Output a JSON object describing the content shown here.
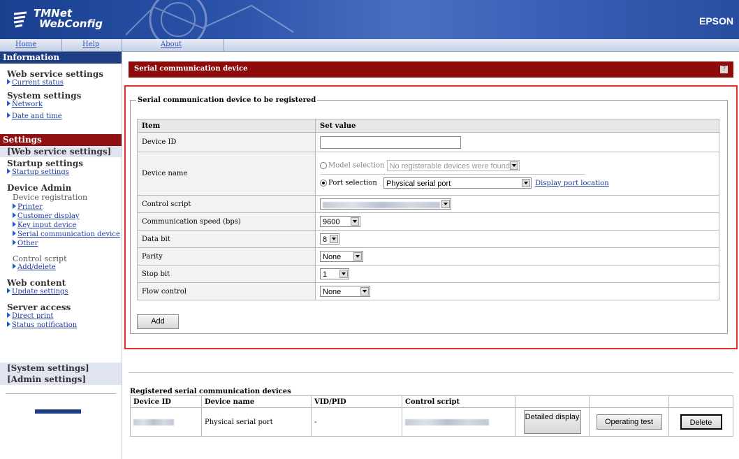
{
  "header": {
    "logo_line1": "TMNet",
    "logo_line2": "WebConfig",
    "brand": "EPSON"
  },
  "nav": {
    "home": "Home",
    "help": "Help",
    "about": "About"
  },
  "sidebar": {
    "info_head": "Information",
    "web_service_settings": "Web service settings",
    "current_status": "Current status",
    "system_settings": "System settings",
    "network": "Network",
    "date_time": "Date and time",
    "settings_head": "Settings",
    "web_service_bar": "[Web service settings]",
    "startup_settings_title": "Startup settings",
    "startup_settings": "Startup settings",
    "device_admin": "Device Admin",
    "device_registration": "Device registration",
    "printer": "Printer",
    "customer_display": "Customer display",
    "key_input_device": "Key input device",
    "serial_comm_device": "Serial communication device",
    "other": "Other",
    "control_script": "Control script",
    "add_delete": "Add/delete",
    "web_content": "Web content",
    "update_settings": "Update settings",
    "server_access": "Server access",
    "direct_print": "Direct print",
    "status_notification": "Status notification",
    "system_settings_bar": "[System settings]",
    "admin_settings_bar": "[Admin settings]"
  },
  "main": {
    "title": "Serial communication device",
    "help_label": "?",
    "fieldset_legend": "Serial communication device to be registered",
    "col_item": "Item",
    "col_set_value": "Set value",
    "rows": {
      "device_id": "Device ID",
      "device_name": "Device name",
      "control_script": "Control script",
      "comm_speed": "Communication speed (bps)",
      "data_bit": "Data bit",
      "parity": "Parity",
      "stop_bit": "Stop bit",
      "flow_control": "Flow control"
    },
    "device_id_value": "",
    "model_selection_label": "Model selection",
    "model_selection_value": "No registerable devices were found.",
    "port_selection_label": "Port selection",
    "port_selection_value": "Physical serial port",
    "display_port_location": "Display port location",
    "comm_speed_value": "9600",
    "data_bit_value": "8",
    "parity_value": "None",
    "stop_bit_value": "1",
    "flow_control_value": "None",
    "add_button": "Add"
  },
  "registered": {
    "title": "Registered serial communication devices",
    "columns": [
      "Device ID",
      "Device name",
      "VID/PID",
      "Control script"
    ],
    "row": {
      "device_name": "Physical serial port",
      "vid_pid": "-"
    },
    "detailed_display": "Detailed display",
    "operating_test": "Operating test",
    "delete": "Delete"
  },
  "colors": {
    "header_blue": "#1e3d83",
    "title_red": "#8e0b0b",
    "highlight_frame": "#e0322e",
    "link": "#1f3b9c"
  }
}
